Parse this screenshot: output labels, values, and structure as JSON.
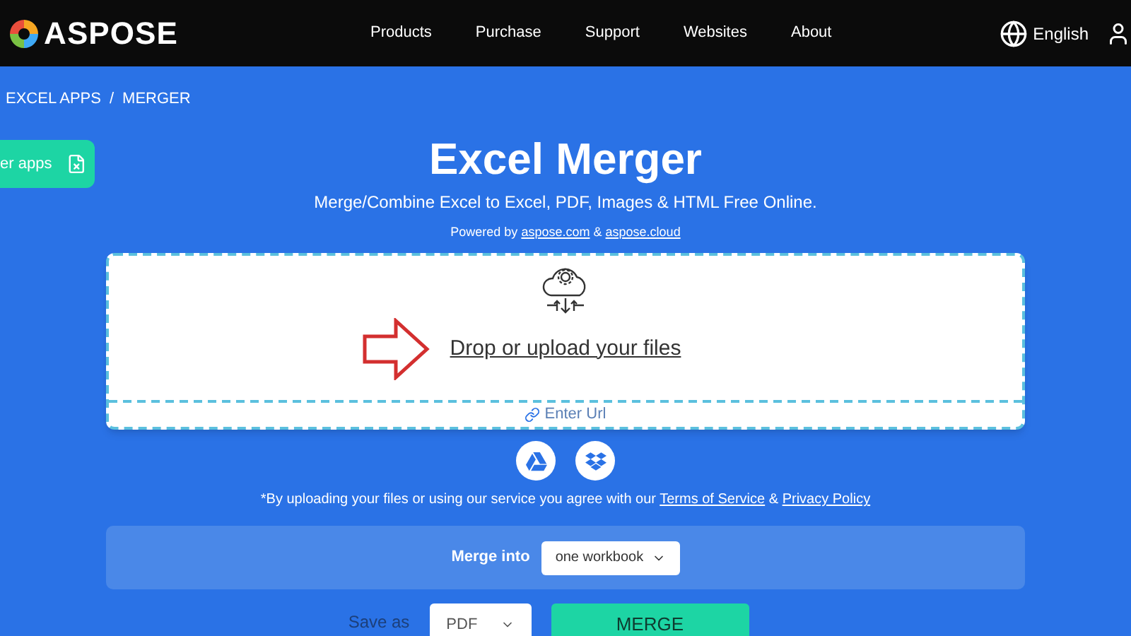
{
  "nav": {
    "logo": "ASPOSE",
    "links": [
      "Products",
      "Purchase",
      "Support",
      "Websites",
      "About"
    ],
    "language": "English"
  },
  "breadcrumb": {
    "items": [
      "EXCEL APPS",
      "MERGER"
    ],
    "separator": "/"
  },
  "side_tab": {
    "label": "er apps"
  },
  "title": "Excel Merger",
  "subtitle": "Merge/Combine Excel to Excel, PDF, Images & HTML Free Online.",
  "powered": {
    "prefix": "Powered by",
    "links": [
      "aspose.com",
      "aspose.cloud"
    ],
    "joiner": "&"
  },
  "upload": {
    "label": "Drop or upload your files",
    "url_link": "Enter Url"
  },
  "terms": {
    "text": "*By uploading your files or using our service you agree with our",
    "links": [
      "Terms of Service",
      "Privacy Policy"
    ],
    "joiner": "&"
  },
  "merge": {
    "label": "Merge into",
    "value": "one workbook"
  },
  "save": {
    "label": "Save as",
    "value": "PDF",
    "button": "MERGE"
  }
}
